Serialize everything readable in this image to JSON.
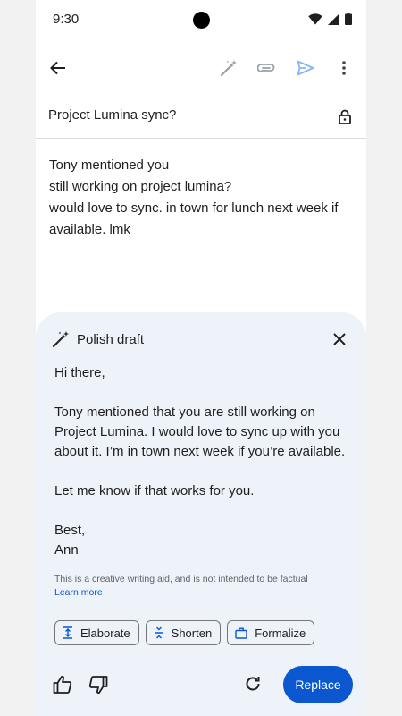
{
  "status_bar": {
    "time": "9:30"
  },
  "toolbar": {
    "icons": [
      "back-arrow-icon",
      "magic-wand-icon",
      "paperclip-icon",
      "send-icon",
      "more-vert-icon"
    ],
    "accent": "#0b57d0"
  },
  "subject": {
    "value": "Project Lumina sync?",
    "icon": "lock-icon"
  },
  "body": {
    "lines": [
      "Tony mentioned you",
      "still working on project lumina?",
      "would love to sync. in town for lunch next week if",
      "available. lmk"
    ]
  },
  "polish": {
    "title": "Polish draft",
    "greeting": "Hi there,",
    "paragraph": "Tony mentioned that you are still working on Project Lumina. I would love to sync up with you about it. I’m in town next week if you’re available.",
    "closing_line": "Let me know if that works for you.",
    "signoff": "Best,",
    "name": "Ann",
    "disclaimer": "This is a creative writing aid, and is not intended to be factual",
    "learn_more": "Learn more",
    "chips": {
      "elaborate": "Elaborate",
      "shorten": "Shorten",
      "formalize": "Formalize"
    },
    "replace_label": "Replace",
    "sheet_color": "#eef3fa"
  }
}
